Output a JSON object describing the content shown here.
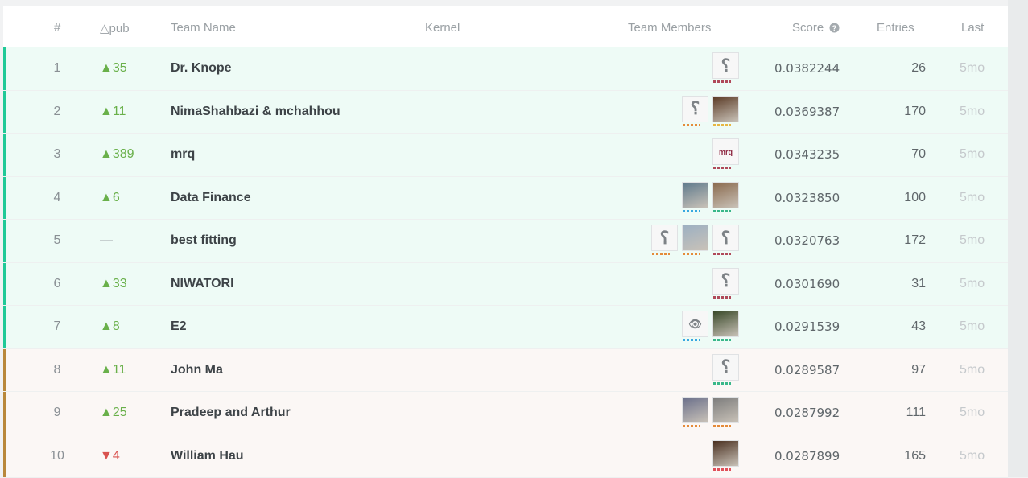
{
  "header": {
    "rank": "#",
    "delta": "△pub",
    "team": "Team Name",
    "kernel": "Kernel",
    "members": "Team Members",
    "score": "Score",
    "score_icon": "help-circle-icon",
    "entries": "Entries",
    "last": "Last"
  },
  "colors": {
    "gold_band": "#20c997",
    "silver_band": "#b9883b",
    "delta_up": "#69b04a",
    "delta_down": "#d9534f"
  },
  "rows": [
    {
      "rank": "1",
      "delta": "▲35",
      "dir": "up",
      "team": "Dr. Knope",
      "score": "0.0382244",
      "entries": "26",
      "last": "5mo",
      "tier": "gold",
      "members": [
        {
          "kind": "default",
          "dots": "#b0495a"
        }
      ]
    },
    {
      "rank": "2",
      "delta": "▲11",
      "dir": "up",
      "team": "NimaShahbazi & mchahhou",
      "score": "0.0369387",
      "entries": "170",
      "last": "5mo",
      "tier": "gold",
      "members": [
        {
          "kind": "default",
          "dots": "#e58b3a"
        },
        {
          "kind": "photo",
          "bg": "#5a3a25",
          "dots": "#e7b743"
        }
      ]
    },
    {
      "rank": "3",
      "delta": "▲389",
      "dir": "up",
      "team": "mrq",
      "score": "0.0343235",
      "entries": "70",
      "last": "5mo",
      "tier": "gold",
      "members": [
        {
          "kind": "text",
          "label": "mrq",
          "dots": "#b0495a"
        }
      ]
    },
    {
      "rank": "4",
      "delta": "▲6",
      "dir": "up",
      "team": "Data Finance",
      "score": "0.0323850",
      "entries": "100",
      "last": "5mo",
      "tier": "gold",
      "members": [
        {
          "kind": "photo",
          "bg": "#5f7a8c",
          "dots": "#38a8e0"
        },
        {
          "kind": "photo",
          "bg": "#8a6a4e",
          "dots": "#3ab88a"
        }
      ]
    },
    {
      "rank": "5",
      "delta": "—",
      "dir": "none",
      "team": "best fitting",
      "score": "0.0320763",
      "entries": "172",
      "last": "5mo",
      "tier": "gold",
      "members": [
        {
          "kind": "default",
          "dots": "#e58b3a"
        },
        {
          "kind": "photo",
          "bg": "#9cb0c2",
          "dots": "#e58b3a"
        },
        {
          "kind": "default",
          "dots": "#b0495a"
        }
      ]
    },
    {
      "rank": "6",
      "delta": "▲33",
      "dir": "up",
      "team": "NIWATORI",
      "score": "0.0301690",
      "entries": "31",
      "last": "5mo",
      "tier": "gold",
      "members": [
        {
          "kind": "default",
          "dots": "#b0495a"
        }
      ]
    },
    {
      "rank": "7",
      "delta": "▲8",
      "dir": "up",
      "team": "E2",
      "score": "0.0291539",
      "entries": "43",
      "last": "5mo",
      "tier": "gold",
      "members": [
        {
          "kind": "eye",
          "dots": "#38a8e0"
        },
        {
          "kind": "photo",
          "bg": "#3a4a2a",
          "dots": "#3ab88a"
        }
      ]
    },
    {
      "rank": "8",
      "delta": "▲11",
      "dir": "up",
      "team": "John Ma",
      "score": "0.0289587",
      "entries": "97",
      "last": "5mo",
      "tier": "silver",
      "members": [
        {
          "kind": "default",
          "dots": "#3ab88a"
        }
      ]
    },
    {
      "rank": "9",
      "delta": "▲25",
      "dir": "up",
      "team": "Pradeep and Arthur",
      "score": "0.0287992",
      "entries": "111",
      "last": "5mo",
      "tier": "silver",
      "members": [
        {
          "kind": "photo",
          "bg": "#6a6f8a",
          "dots": "#e58b3a"
        },
        {
          "kind": "photo",
          "bg": "#7c7c7c",
          "dots": "#e58b3a"
        }
      ]
    },
    {
      "rank": "10",
      "delta": "▼4",
      "dir": "down",
      "team": "William Hau",
      "score": "0.0287899",
      "entries": "165",
      "last": "5mo",
      "tier": "silver",
      "members": [
        {
          "kind": "photo",
          "bg": "#4a3020",
          "dots": "#e0505a"
        }
      ]
    }
  ]
}
